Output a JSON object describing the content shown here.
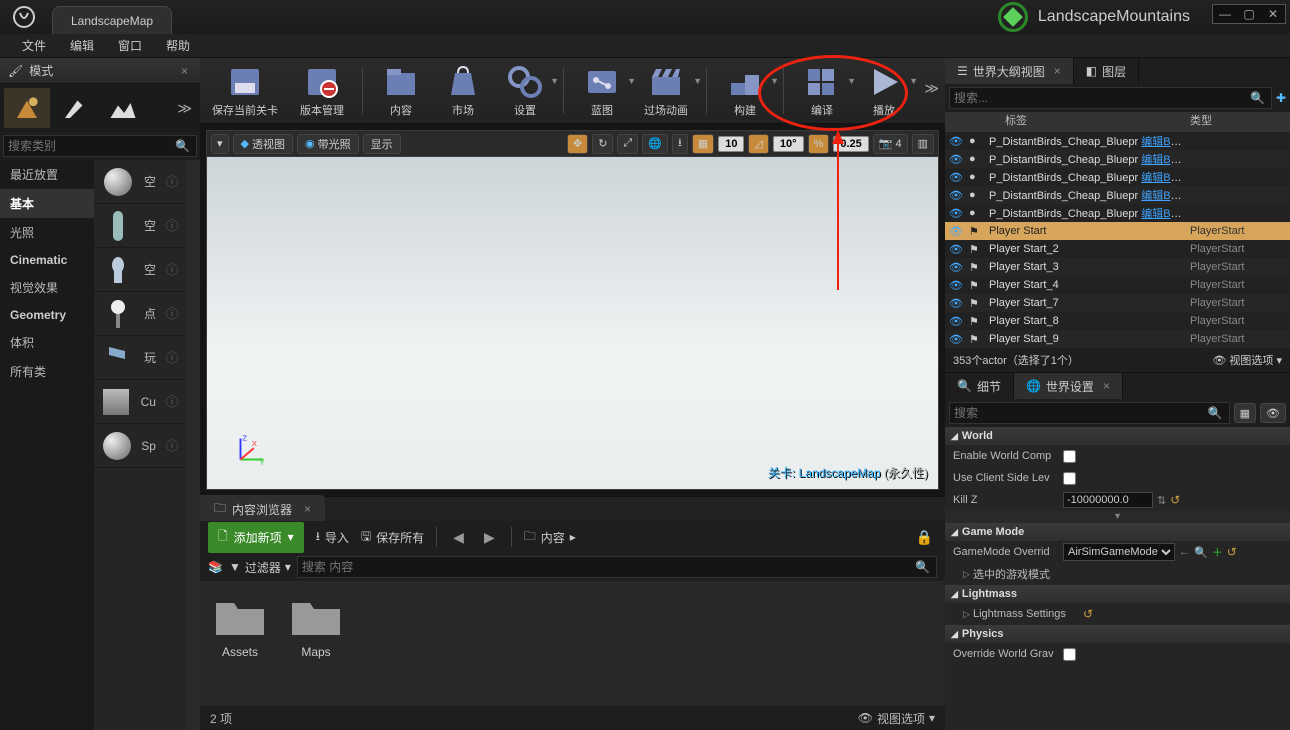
{
  "title_tab": "LandscapeMap",
  "project_name": "LandscapeMountains",
  "menu": {
    "file": "文件",
    "edit": "编辑",
    "window": "窗口",
    "help": "帮助"
  },
  "modes_panel": {
    "title": "模式",
    "search_placeholder": "搜索类别",
    "categories": [
      "最近放置",
      "基本",
      "光照",
      "Cinematic",
      "视觉效果",
      "Geometry",
      "体积",
      "所有类"
    ],
    "selected_category": "基本",
    "items": [
      {
        "label": "空"
      },
      {
        "label": "空"
      },
      {
        "label": "空"
      },
      {
        "label": "点"
      },
      {
        "label": "玩"
      },
      {
        "label": "Cu"
      },
      {
        "label": "Sp"
      }
    ]
  },
  "toolbar": {
    "save": "保存当前关卡",
    "source": "版本管理",
    "content": "内容",
    "market": "市场",
    "settings": "设置",
    "blueprint": "蓝图",
    "cinematics": "过场动画",
    "build": "构建",
    "compile": "编译",
    "play": "播放"
  },
  "viewport": {
    "perspective": "透视图",
    "lit": "带光照",
    "show": "显示",
    "grid_snap": "10",
    "angle_snap": "10°",
    "scale_snap": "0.25",
    "cam_speed": "4",
    "level_label_prefix": "关卡:",
    "level_name": "LandscapeMap",
    "level_perm": "(永久性)"
  },
  "content_browser": {
    "tab": "内容浏览器",
    "add_new": "添加新项",
    "import": "导入",
    "save_all": "保存所有",
    "path_root": "内容",
    "filter": "过滤器",
    "search_placeholder": "搜索 内容",
    "folders": [
      "Assets",
      "Maps"
    ],
    "footer_count": "2 项",
    "view_options": "视图选项"
  },
  "outliner": {
    "tab1": "世界大纲视图",
    "tab2": "图层",
    "search_placeholder": "搜索...",
    "col_label": "标签",
    "col_type": "类型",
    "rows": [
      {
        "name": "P_DistantBirds_Cheap_Bluepr",
        "link": "编辑BP_Birds",
        "type": ""
      },
      {
        "name": "P_DistantBirds_Cheap_Bluepr",
        "link": "编辑BP_Birds",
        "type": ""
      },
      {
        "name": "P_DistantBirds_Cheap_Bluepr",
        "link": "编辑BP_Birds",
        "type": ""
      },
      {
        "name": "P_DistantBirds_Cheap_Bluepr",
        "link": "编辑BP_Birds",
        "type": ""
      },
      {
        "name": "P_DistantBirds_Cheap_Bluepr",
        "link": "编辑BP_Birds",
        "type": ""
      },
      {
        "name": "Player Start",
        "type": "PlayerStart",
        "selected": true
      },
      {
        "name": "Player Start_2",
        "type": "PlayerStart"
      },
      {
        "name": "Player Start_3",
        "type": "PlayerStart"
      },
      {
        "name": "Player Start_4",
        "type": "PlayerStart"
      },
      {
        "name": "Player Start_7",
        "type": "PlayerStart"
      },
      {
        "name": "Player Start_8",
        "type": "PlayerStart"
      },
      {
        "name": "Player Start_9",
        "type": "PlayerStart"
      }
    ],
    "footer_count": "353个actor（选择了1个）",
    "view_options": "视图选项"
  },
  "details": {
    "tab_details": "细节",
    "tab_world": "世界设置",
    "search_placeholder": "搜索",
    "section_world": "World",
    "world_enable_comp": "Enable World Comp",
    "world_use_client": "Use Client Side Lev",
    "world_kill_z": "Kill Z",
    "world_kill_z_val": "-10000000.0",
    "section_gamemode": "Game Mode",
    "gm_override": "GameMode Overrid",
    "gm_value": "AirSimGameMode",
    "gm_sub": "选中的游戏模式",
    "section_lightmass": "Lightmass",
    "lm_settings": "Lightmass Settings",
    "section_physics": "Physics",
    "phys_override": "Override World Grav"
  }
}
